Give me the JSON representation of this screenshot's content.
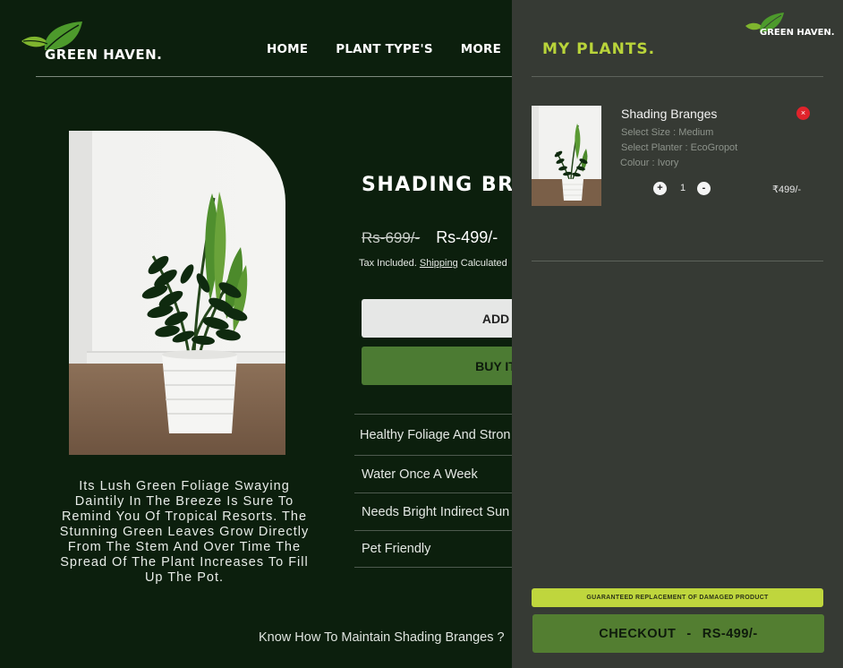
{
  "brand": {
    "name": "GREEN HAVEN."
  },
  "nav": {
    "items": [
      "HOME",
      "PLANT TYPE'S",
      "MORE"
    ]
  },
  "product": {
    "title": "SHADING BRA",
    "price_old": "Rs-699/-",
    "price_new": "Rs-499/-",
    "tax_prefix": "Tax Included.",
    "tax_link": "Shipping",
    "tax_suffix": "Calculated",
    "add_button": "ADD",
    "buy_button": "BUY IT",
    "features": [
      "Healthy Foliage And Stron",
      "Water Once A Week",
      "Needs Bright Indirect Sun",
      "Pet Friendly"
    ],
    "description": "Its Lush Green Foliage Swaying Daintily In The Breeze Is Sure To Remind You Of Tropical Resorts. The Stunning Green Leaves Grow Directly From The Stem And Over Time The Spread Of The Plant Increases To Fill Up The Pot.",
    "maintain_link": "Know How To Maintain Shading Branges ?"
  },
  "cart": {
    "title": "MY PLANTS.",
    "brand": "GREEN HAVEN.",
    "item": {
      "name": "Shading Branges",
      "size": "Select Size : Medium",
      "planter": "Select Planter : EcoGropot",
      "colour": "Colour : Ivory",
      "quantity": "1",
      "price": "₹499/-",
      "remove": "×",
      "plus": "+",
      "minus": "-"
    },
    "guarantee": "GUARANTEED REPLACEMENT OF DAMAGED PRODUCT",
    "checkout_label": "CHECKOUT",
    "checkout_sep": "-",
    "checkout_total": "RS-499/-"
  },
  "colors": {
    "background": "#0c1f0d",
    "drawer": "#363a34",
    "accent": "#b9d43a",
    "button_green": "#537e31",
    "remove_red": "#e0232b"
  }
}
